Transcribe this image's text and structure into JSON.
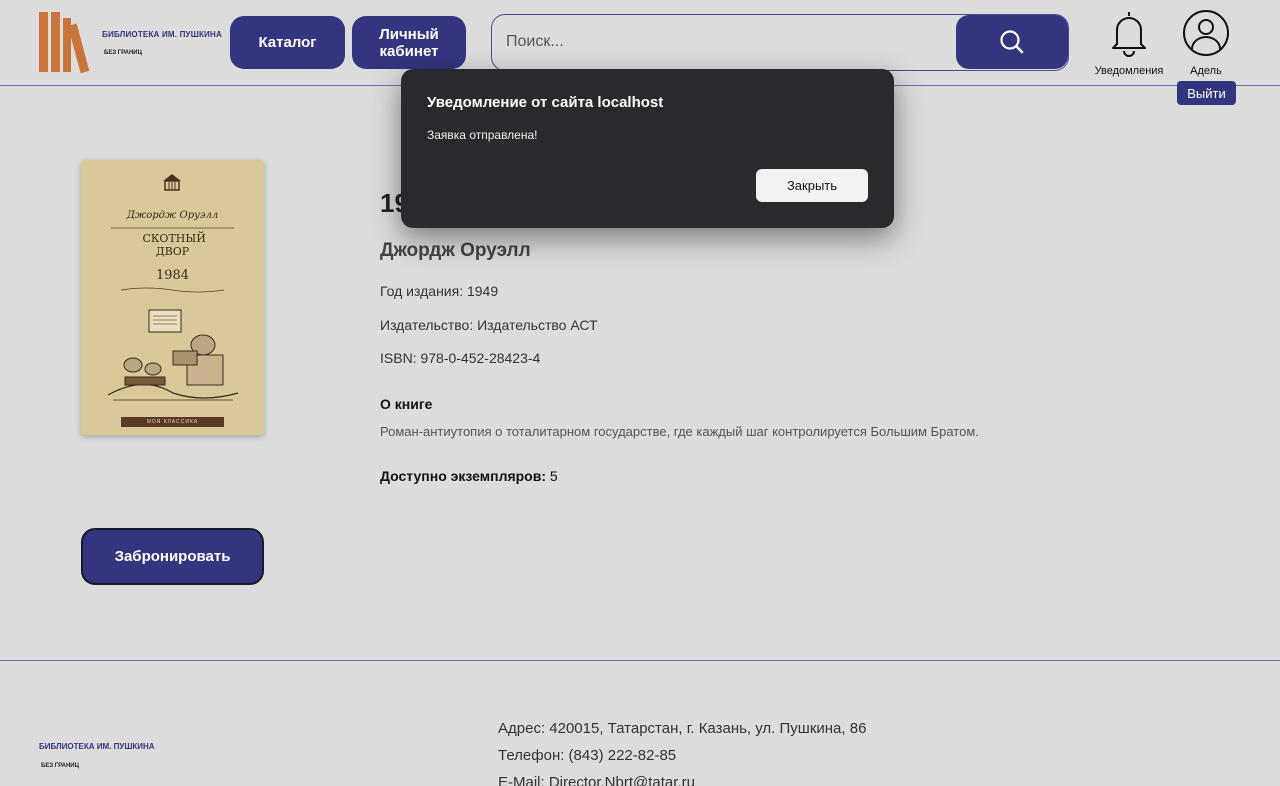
{
  "header": {
    "logo_title": "БИБЛИОТЕКА ИМ. ПУШКИНА",
    "logo_sub": "БЕЗ ГРАНИЦ",
    "nav": {
      "catalog": "Каталог",
      "cabinet": "Личный кабинет"
    },
    "search": {
      "placeholder": "Поиск...",
      "icon": "search-icon"
    },
    "notifications_label": "Уведомления",
    "user_name": "Адель",
    "logout_label": "Выйти"
  },
  "book": {
    "cover": {
      "author": "Джордж Оруэлл",
      "title": "СКОТНЫЙ ДВОР",
      "title2": "1984",
      "series": "МОЯ КЛАССИКА"
    },
    "title": "1984",
    "author": "Джордж Оруэлл",
    "year": "Год издания: 1949",
    "publisher": "Издательство: Издательство АСТ",
    "isbn": "ISBN: 978-0-452-28423-4",
    "about_heading": "О книге",
    "about_text": "Роман-антиутопия о тоталитарном государстве, где каждый шаг контролируется Большим Братом.",
    "available_label": "Доступно экземпляров:",
    "available_count": "5",
    "reserve_label": "Забронировать"
  },
  "footer": {
    "logo_title": "БИБЛИОТЕКА ИМ. ПУШКИНА",
    "logo_sub": "БЕЗ ГРАНИЦ",
    "address": "Адрес: 420015, Татарстан, г. Казань, ул. Пушкина, 86",
    "phone": "Телефон: (843) 222-82-85",
    "email": "E-Mail: Director.Nbrt@tatar.ru"
  },
  "dialog": {
    "title": "Уведомление от сайта localhost",
    "message": "Заявка отправлена!",
    "close_label": "Закрыть"
  },
  "colors": {
    "accent": "#34357f",
    "background": "#dcdcdc",
    "dialog_bg": "#2a292e",
    "logo_books": "#c8743a"
  }
}
